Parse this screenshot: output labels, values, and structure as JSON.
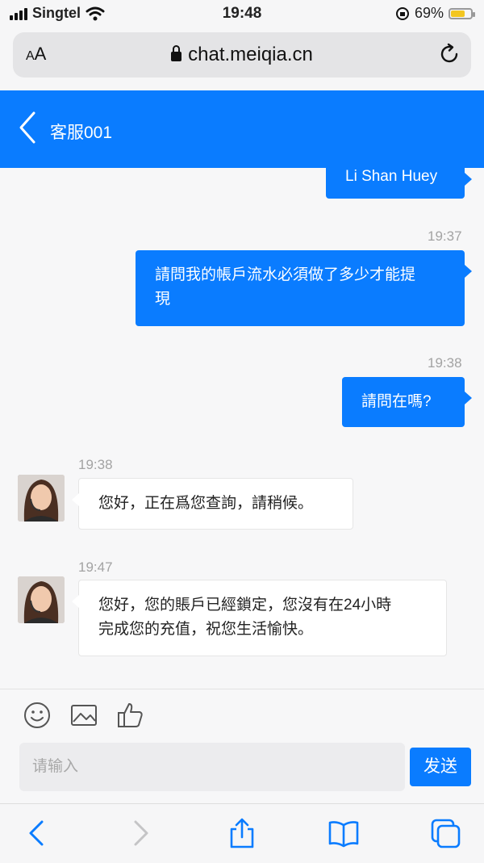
{
  "status_bar": {
    "carrier": "Singtel",
    "time": "19:48",
    "battery_percent": "69%",
    "battery_level": 0.69
  },
  "browser": {
    "aa_label_small": "A",
    "aa_label_large": "A",
    "url": "chat.meiqia.cn"
  },
  "header": {
    "title": "客服001"
  },
  "messages": {
    "m0": {
      "text": "Li Shan Huey"
    },
    "m1": {
      "time": "19:37",
      "text_line1": "請問我的帳戶流水必須做了多少才能提",
      "text_line2": "現"
    },
    "m2": {
      "time": "19:38",
      "text": "請問在嗎?"
    },
    "m3": {
      "time": "19:38",
      "text": "您好，正在爲您查詢，請稍候。"
    },
    "m4": {
      "time": "19:47",
      "text_line1": "您好，您的賬戶已經鎖定，您沒有在24小時",
      "text_line2": "完成您的充值，祝您生活愉快。"
    }
  },
  "composer": {
    "placeholder": "请输入",
    "send_label": "发送"
  },
  "colors": {
    "accent": "#0a7cff",
    "battery": "#f3c620"
  }
}
